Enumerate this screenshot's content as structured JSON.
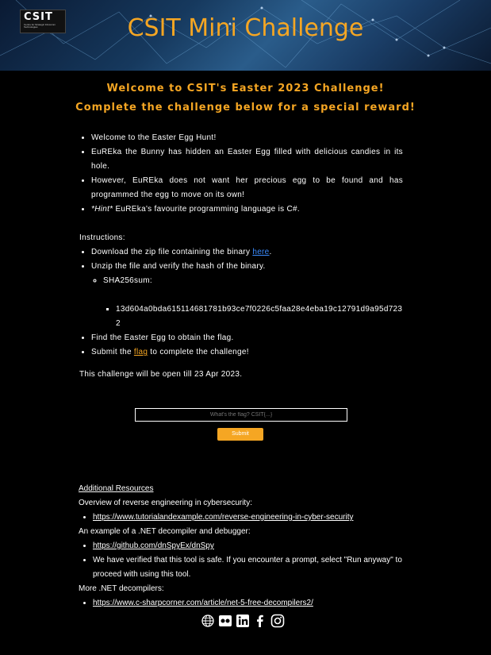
{
  "header": {
    "logo_text": "CSIT",
    "logo_subtext": "Centre for Strategic Infocomm Technologies",
    "title": "CSIT Mini Challenge"
  },
  "welcome": {
    "line1": "Welcome to CSIT's Easter 2023 Challenge!",
    "line2": "Complete the challenge below for a special reward!"
  },
  "story": [
    "Welcome to the Easter Egg Hunt!",
    "EuREka the Bunny has hidden an Easter Egg filled with delicious candies in its hole.",
    "However, EuREka does not want her precious egg to be found and has programmed the egg to move on its own!"
  ],
  "hint": {
    "label": "*Hint*",
    "text": " EuREka's favourite programming language is C#."
  },
  "instructions": {
    "heading": "Instructions:",
    "step1_prefix": "Download the zip file containing the binary ",
    "step1_link": "here",
    "step1_suffix": ".",
    "step2": "Unzip the file and verify the hash of the binary.",
    "sha_label": "SHA256sum:",
    "sha_value": "13d604a0bda615114681781b93ce7f0226c5faa28e4eba19c12791d9a95d7232",
    "step3": "Find the Easter Egg to obtain the flag.",
    "step4_prefix": "Submit the ",
    "step4_link": "flag",
    "step4_suffix": " to complete the challenge!"
  },
  "open_till": "This challenge will be open till 23 Apr 2023.",
  "form": {
    "placeholder": "What's the flag? CSIT{...}",
    "submit_label": "Submit"
  },
  "resources": {
    "heading": "Additional Resources",
    "sections": [
      {
        "title": "Overview of reverse engineering in cybersecurity:",
        "links": [
          "https://www.tutorialandexample.com/reverse-engineering-in-cyber-security"
        ]
      },
      {
        "title": "An example of a .NET decompiler and debugger:",
        "links": [
          "https://github.com/dnSpyEx/dnSpy"
        ],
        "note": "We have verified that this tool is safe. If you encounter a prompt, select \"Run anyway\" to proceed with using this tool."
      },
      {
        "title": "More .NET decompilers:",
        "links": [
          "https://www.c-sharpcorner.com/article/net-5-free-decompilers2/"
        ]
      }
    ]
  },
  "socials": [
    "globe-icon",
    "careers-icon",
    "linkedin-icon",
    "facebook-icon",
    "instagram-icon"
  ],
  "colors": {
    "accent": "#f5a623",
    "link": "#3b8cff",
    "background": "#000000"
  }
}
